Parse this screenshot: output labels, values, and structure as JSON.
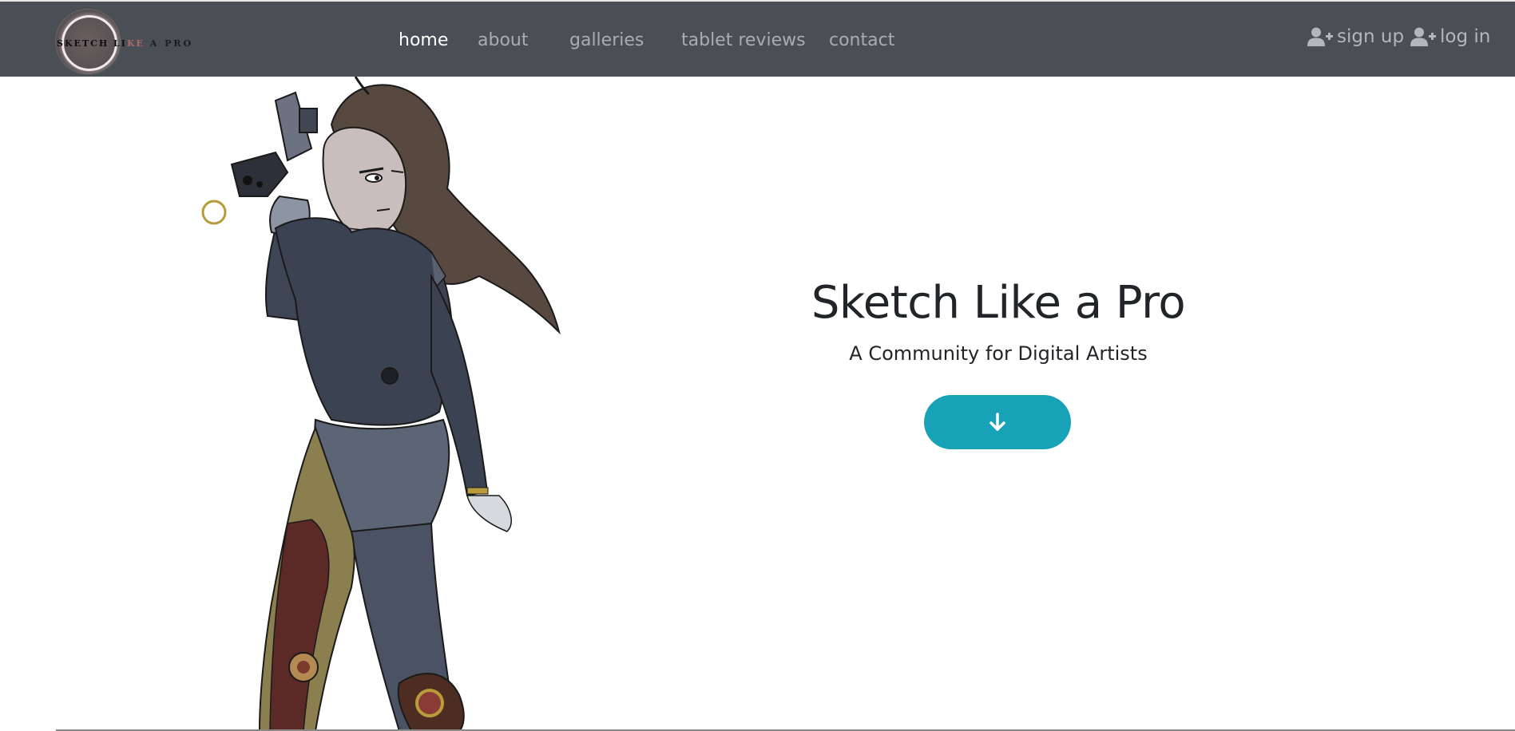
{
  "brand": {
    "logo_text_part1": "SKETCH LI",
    "logo_text_part2": "KE",
    "logo_text_part3": " A PRO"
  },
  "nav": {
    "home": "home",
    "about": "about",
    "galleries": "galleries",
    "tablet_reviews": "tablet reviews",
    "contact": "contact",
    "active": "home"
  },
  "auth": {
    "signup_label": "sign up",
    "login_label": "log in",
    "icon": "user-plus-icon"
  },
  "hero": {
    "title": "Sketch Like a Pro",
    "subtitle": "A Community for Digital Artists",
    "button_icon": "arrow-down-icon",
    "art_subject": "character-illustration"
  },
  "colors": {
    "navbar_bg": "#4a4e55",
    "nav_active": "#ffffff",
    "nav_inactive": "#a9adb2",
    "accent": "#17a2b8",
    "text_dark": "#212529"
  }
}
